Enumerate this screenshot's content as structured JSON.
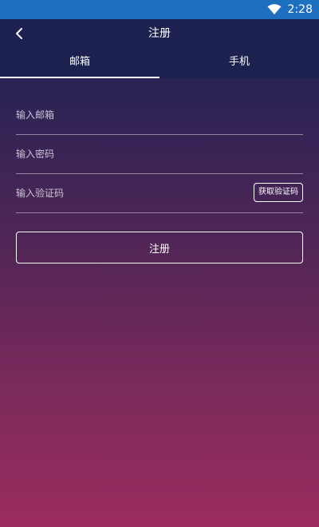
{
  "status_bar": {
    "time": "2:28",
    "icons": [
      "wifi-icon"
    ]
  },
  "header": {
    "title": "注册",
    "back_icon": "chevron-left-icon"
  },
  "tabs": [
    {
      "label": "邮箱",
      "active": true
    },
    {
      "label": "手机",
      "active": false
    }
  ],
  "form": {
    "email_placeholder": "输入邮箱",
    "password_placeholder": "输入密码",
    "code_placeholder": "输入验证码",
    "get_code_label": "获取验证码",
    "submit_label": "注册"
  },
  "colors": {
    "status_bar": "#1f6fc0",
    "header_bg": "#1c2150",
    "gradient_top": "#1d2150",
    "gradient_bottom": "#9b2d5e",
    "text": "#ffffff"
  }
}
